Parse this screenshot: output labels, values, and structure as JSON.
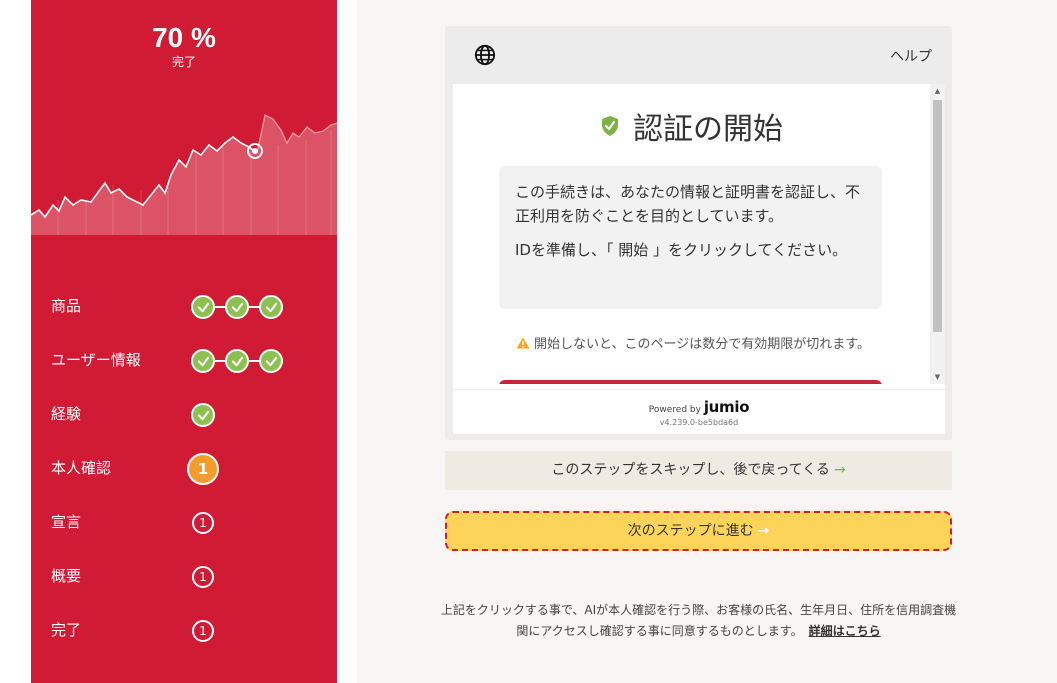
{
  "progress": {
    "percent_text": "70 %",
    "label": "完了",
    "value": 70
  },
  "steps": [
    {
      "label": "商品",
      "state": "done",
      "count": 3
    },
    {
      "label": "ユーザー情報",
      "state": "done",
      "count": 3
    },
    {
      "label": "経験",
      "state": "done",
      "count": 1
    },
    {
      "label": "本人確認",
      "state": "active",
      "number": "1"
    },
    {
      "label": "宣言",
      "state": "pending",
      "number": "1"
    },
    {
      "label": "概要",
      "state": "pending",
      "number": "1"
    },
    {
      "label": "完了",
      "state": "pending",
      "number": "1"
    }
  ],
  "verification": {
    "help_label": "ヘルプ",
    "title": "認証の開始",
    "paragraph1": "この手続きは、あなたの情報と証明書を認証し、不正利用を防ぐことを目的としています。",
    "paragraph2": "IDを準備し、「 開始 」をクリックしてください。",
    "warning": "開始しないと、このページは数分で有効期限が切れます。",
    "powered_by": "Powered by",
    "brand": "jumio",
    "version": "v4.239.0-be5bda6d"
  },
  "actions": {
    "skip_label": "このステップをスキップし、後で戻ってくる",
    "next_label": "次のステップに進む"
  },
  "consent": {
    "text": "上記をクリックする事で、AIが本人確認を行う際、お客様の氏名、生年月日、住所を信用調査機関にアクセスし確認する事に同意するものとします。",
    "link_label": "詳細はこちら"
  },
  "colors": {
    "sidebar_bg": "#d11a33",
    "check_green": "#8cc152",
    "active_orange": "#f39c2a",
    "next_button_yellow": "#fcd45a",
    "skip_button_bg": "#efebe3",
    "shield_green": "#7cb342"
  }
}
